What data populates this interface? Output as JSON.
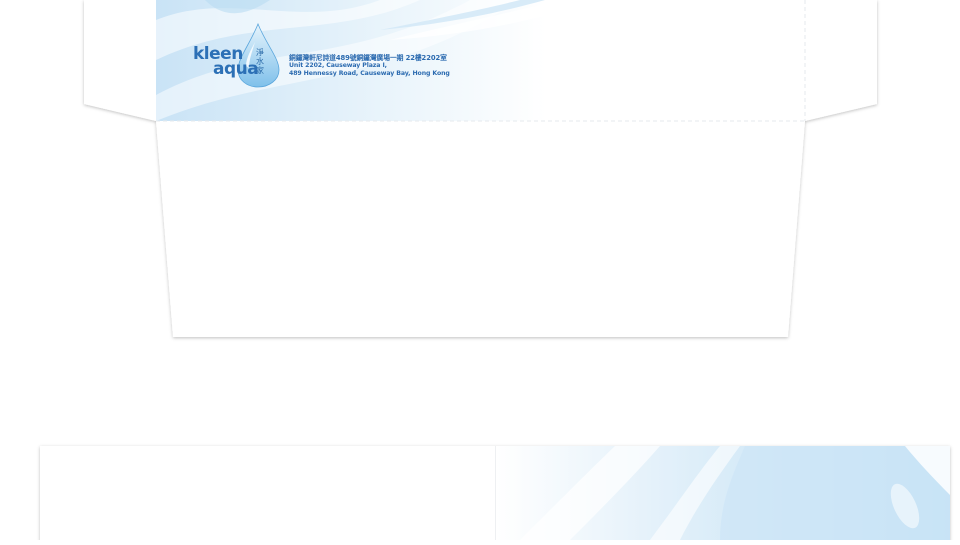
{
  "brand": {
    "logo_word_1": "kleen",
    "logo_word_2": "aqua",
    "logo_chinese": [
      "淨",
      "水",
      "家"
    ]
  },
  "address": {
    "line_chinese": "銅鑼灣軒尼詩道489號銅鑼灣廣場一期 22樓2202室",
    "line_1": "Unit 2202, Causeway Plaza I,",
    "line_2": "489 Hennessy Road, Causeway Bay, Hong Kong"
  },
  "colors": {
    "brand_blue": "#2c70b6",
    "water_light": "#d6ebf8",
    "water_mid": "#aed6f1",
    "paper": "#ffffff",
    "fold_line": "#e6eaee"
  },
  "icons": {
    "logo_mark": "water-drop-icon"
  }
}
